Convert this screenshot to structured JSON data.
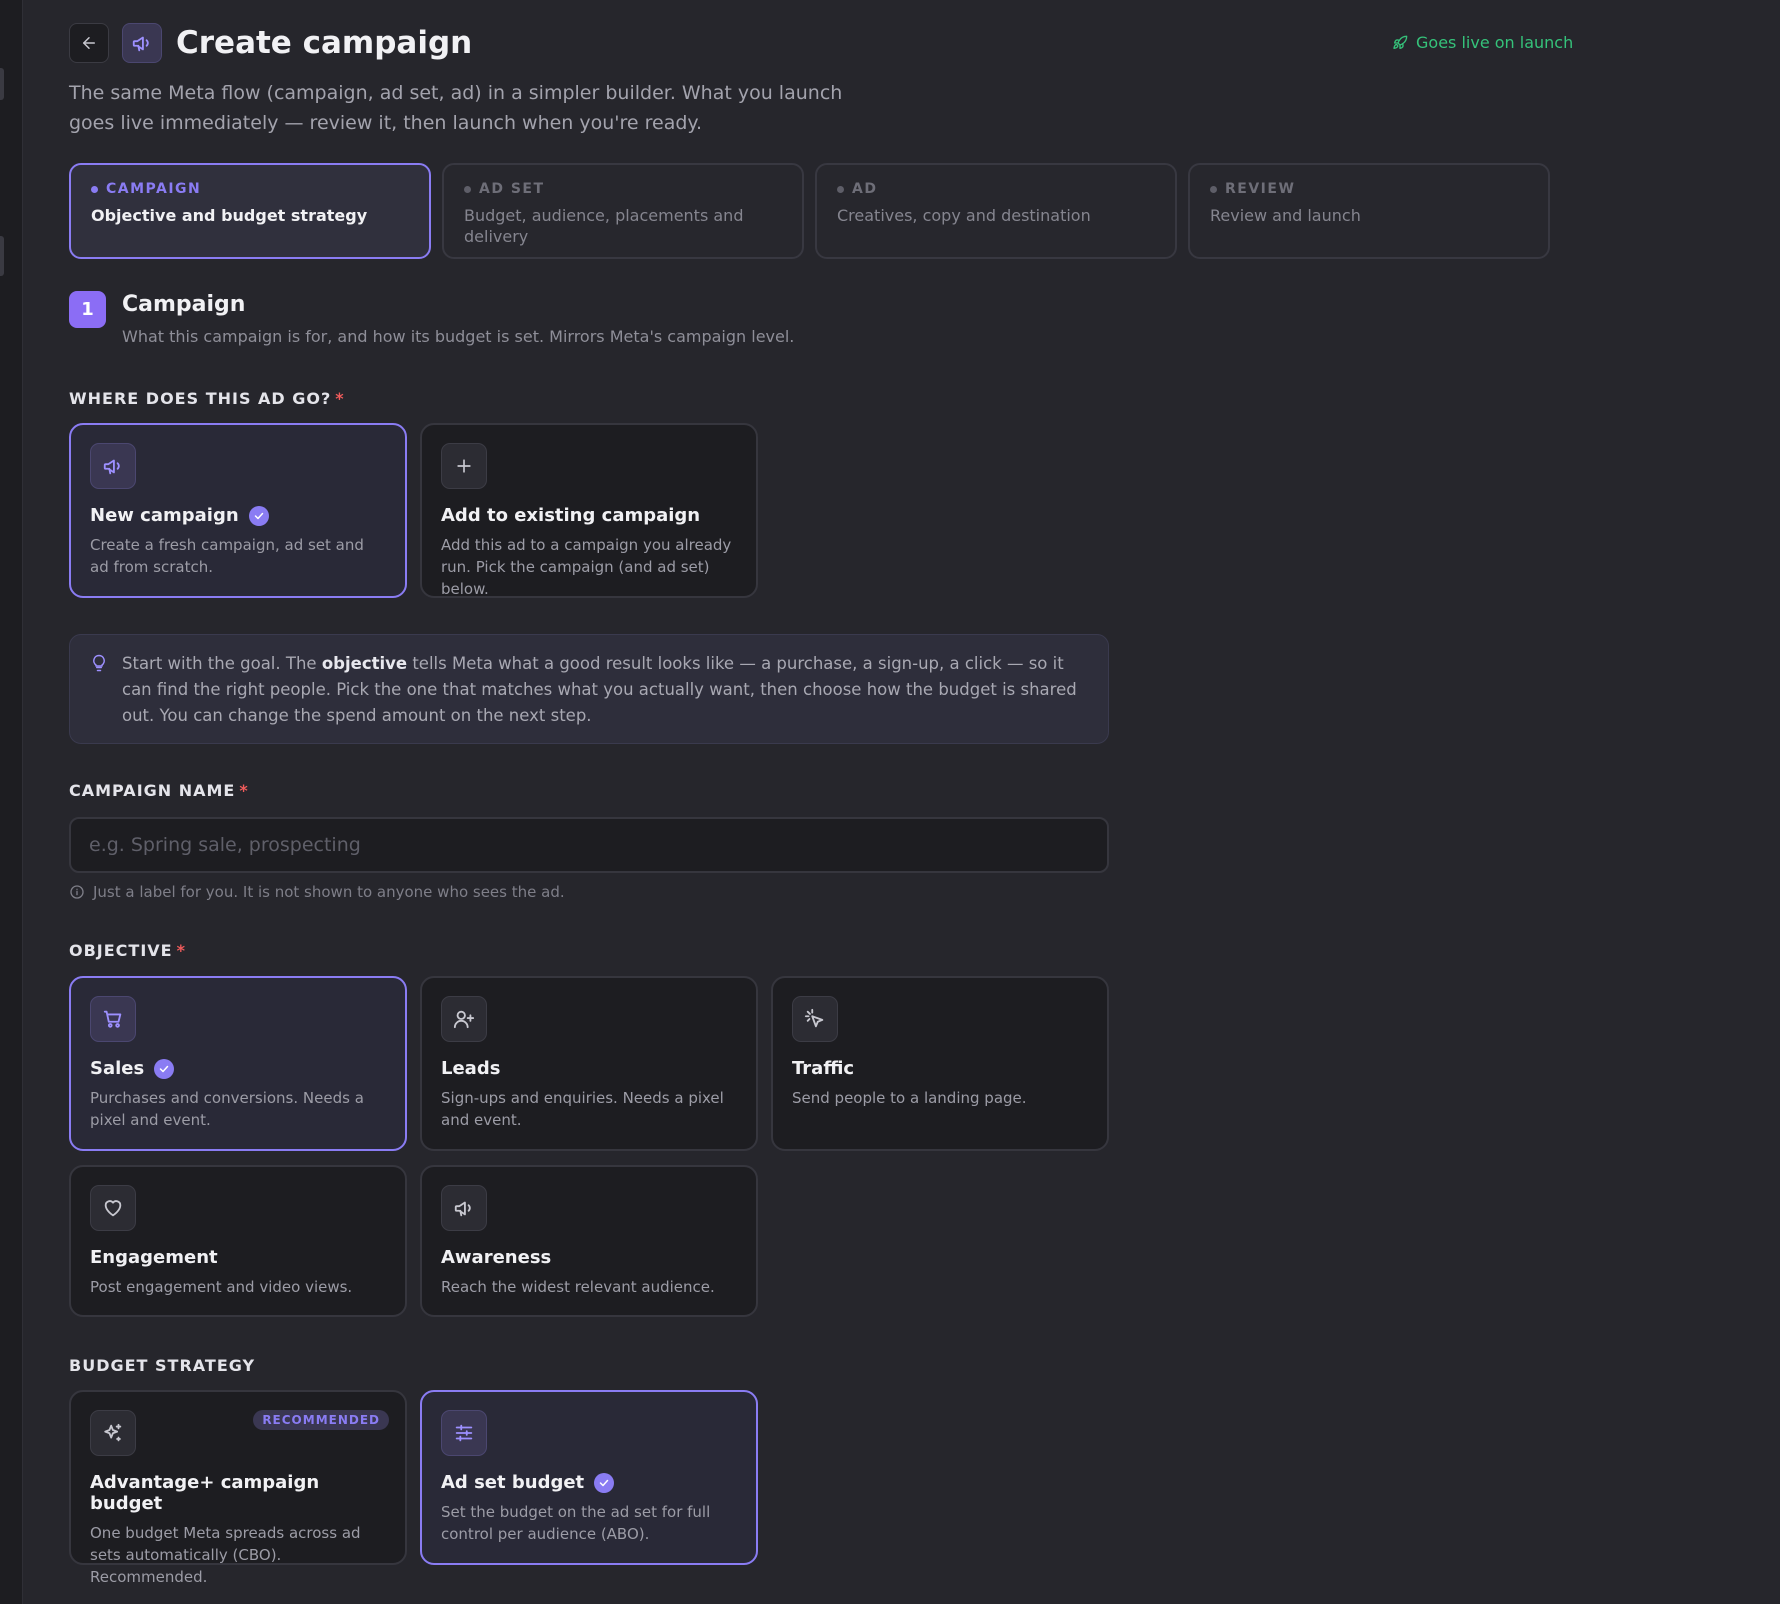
{
  "header": {
    "title": "Create campaign",
    "live_label": "Goes live on launch",
    "subtitle": "The same Meta flow (campaign, ad set, ad) in a simpler builder. What you launch goes live immediately — review it, then launch when you're ready."
  },
  "steps": [
    {
      "kicker": "CAMPAIGN",
      "desc": "Objective and budget strategy"
    },
    {
      "kicker": "AD SET",
      "desc": "Budget, audience, placements and delivery"
    },
    {
      "kicker": "AD",
      "desc": "Creatives, copy and destination"
    },
    {
      "kicker": "REVIEW",
      "desc": "Review and launch"
    }
  ],
  "section": {
    "number": "1",
    "title": "Campaign",
    "desc": "What this campaign is for, and how its budget is set. Mirrors Meta's campaign level."
  },
  "destination": {
    "label": "WHERE DOES THIS AD GO?",
    "required": "*",
    "options": [
      {
        "title": "New campaign",
        "desc": "Create a fresh campaign, ad set and ad from scratch.",
        "icon": "megaphone-icon"
      },
      {
        "title": "Add to existing campaign",
        "desc": "Add this ad to a campaign you already run. Pick the campaign (and ad set) below.",
        "icon": "plus-icon"
      }
    ]
  },
  "tip": {
    "pre": "Start with the goal. The ",
    "bold": "objective",
    "post": " tells Meta what a good result looks like — a purchase, a sign-up, a click — so it can find the right people. Pick the one that matches what you actually want, then choose how the budget is shared out. You can change the spend amount on the next step."
  },
  "campaign_name": {
    "label": "CAMPAIGN NAME",
    "required": "*",
    "value": "",
    "placeholder": "e.g. Spring sale, prospecting",
    "help": "Just a label for you. It is not shown to anyone who sees the ad."
  },
  "objective": {
    "label": "OBJECTIVE",
    "required": "*",
    "options": [
      {
        "title": "Sales",
        "desc": "Purchases and conversions. Needs a pixel and event.",
        "icon": "cart-icon"
      },
      {
        "title": "Leads",
        "desc": "Sign-ups and enquiries. Needs a pixel and event.",
        "icon": "user-plus-icon"
      },
      {
        "title": "Traffic",
        "desc": "Send people to a landing page.",
        "icon": "cursor-click-icon"
      },
      {
        "title": "Engagement",
        "desc": "Post engagement and video views.",
        "icon": "heart-icon"
      },
      {
        "title": "Awareness",
        "desc": "Reach the widest relevant audience.",
        "icon": "megaphone-icon"
      }
    ]
  },
  "budget": {
    "label": "BUDGET STRATEGY",
    "options": [
      {
        "title": "Advantage+ campaign budget",
        "desc": "One budget Meta spreads across ad sets automatically (CBO). Recommended.",
        "badge": "RECOMMENDED",
        "icon": "sparkles-icon"
      },
      {
        "title": "Ad set budget",
        "desc": "Set the budget on the ad set for full control per audience (ABO).",
        "icon": "sliders-icon"
      }
    ]
  },
  "colors": {
    "accent": "#8a7cf3",
    "live": "#35c27a",
    "required": "#ef5b5b",
    "background": "#26262c"
  }
}
